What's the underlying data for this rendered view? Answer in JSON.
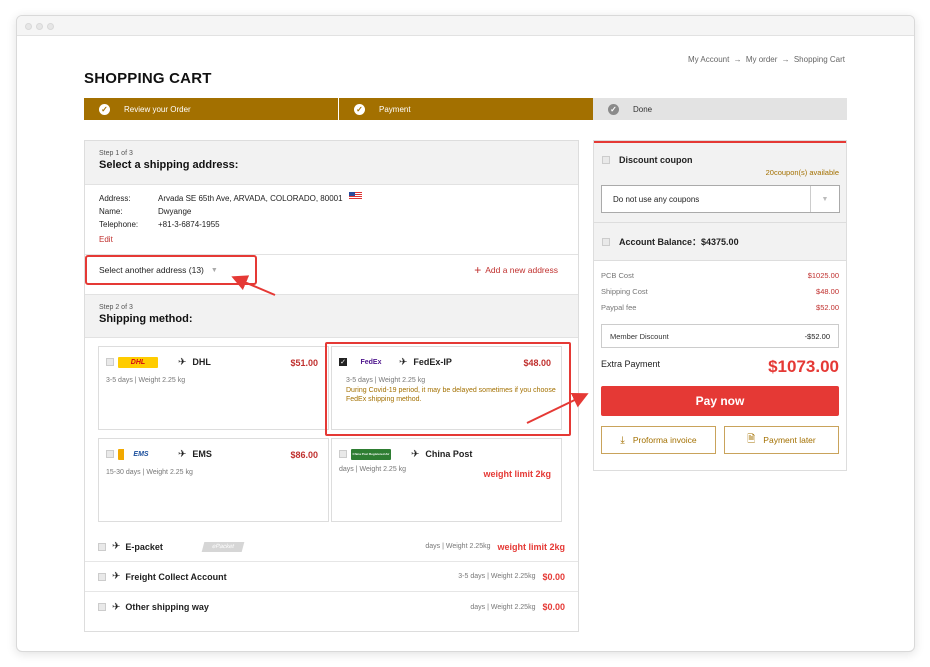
{
  "breadcrumb": [
    "My Account",
    "My order",
    "Shopping Cart"
  ],
  "breadcrumb_sep": "→",
  "page_title": "SHOPPING CART",
  "progress": {
    "steps": [
      {
        "label": "Review your Order"
      },
      {
        "label": "Payment"
      },
      {
        "label": "Done"
      }
    ]
  },
  "step1": {
    "small": "Step 1 of 3",
    "title": "Select a shipping address:",
    "address_label": "Address:",
    "address_value": "Arvada SE 65th Ave, ARVADA, COLORADO, 80001",
    "name_label": "Name:",
    "name_value": "Dwyange",
    "phone_label": "Telephone:",
    "phone_value": "+81-3-6874-1955",
    "edit": "Edit",
    "select_another": "Select another address (13)",
    "add_new": "Add a new address"
  },
  "step2": {
    "small": "Step 2 of 3",
    "title": "Shipping method:",
    "carriers": [
      {
        "name": "DHL",
        "logo": "DHL",
        "price": "$51.00",
        "days": "3-5 days | Weight 2.25 kg",
        "note": "",
        "checked": false
      },
      {
        "name": "FedEx-IP",
        "logo": "FedEx",
        "price": "$48.00",
        "days": "3-5 days | Weight 2.25 kg",
        "note": "During Covid-19 period, it may be delayed sometimes if you choose FedEx shipping method.",
        "checked": true
      },
      {
        "name": "EMS",
        "logo": "EMS",
        "price": "$86.00",
        "days": "15-30 days | Weight 2.25 kg",
        "note": "",
        "checked": false
      },
      {
        "name": "China Post",
        "logo": "China Post Registered Air",
        "price": "weight limit 2kg",
        "days": "days | Weight 2.25 kg",
        "note": "",
        "checked": false
      }
    ],
    "lines": [
      {
        "name": "E-packet",
        "tag": "ePacket",
        "days": "days | Weight 2.25kg",
        "value": "weight limit 2kg"
      },
      {
        "name": "Freight Collect Account",
        "days": "3-5 days | Weight 2.25kg",
        "value": "$0.00"
      },
      {
        "name": "Other shipping way",
        "days": "days | Weight 2.25kg",
        "value": "$0.00"
      }
    ]
  },
  "summary": {
    "coupon_title": "Discount coupon",
    "coupon_available": "20coupon(s) available",
    "coupon_select": "Do not use any coupons",
    "balance_label": "Account Balance：",
    "balance_value": "$4375.00",
    "pcb_label": "PCB Cost",
    "pcb_value": "$1025.00",
    "ship_label": "Shipping Cost",
    "ship_value": "$48.00",
    "paypal_label": "Paypal fee",
    "paypal_value": "$52.00",
    "member_label": "Member Discount",
    "member_value": "-$52.00",
    "extra_label": "Extra Payment",
    "extra_value": "$1073.00",
    "pay_now": "Pay now",
    "proforma": "Proforma invoice",
    "pay_later": "Payment later"
  },
  "colors": {
    "accent": "#a37000",
    "highlight": "#e53935",
    "price": "#c0302e"
  },
  "icons": [
    "check-icon",
    "plane-icon",
    "plus-icon",
    "caret-down-icon",
    "download-icon",
    "dollar-doc-icon",
    "us-flag-icon"
  ]
}
